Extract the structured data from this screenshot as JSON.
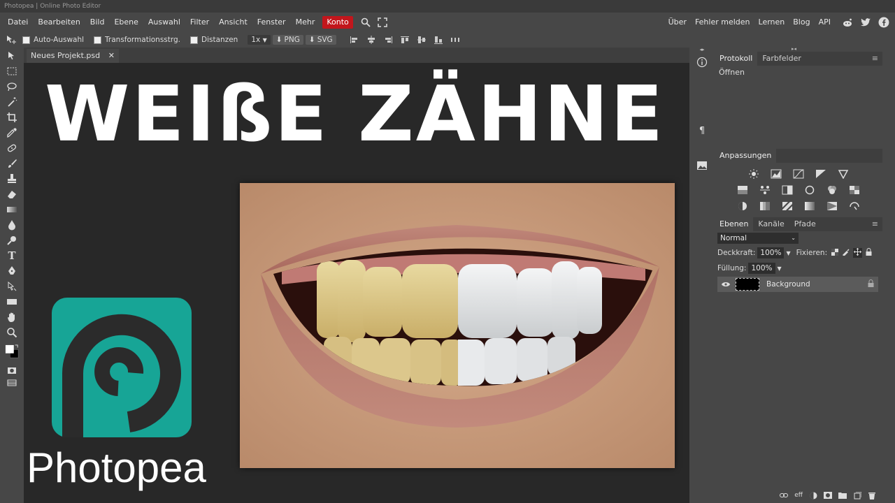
{
  "window": {
    "title": "Photopea | Online Photo Editor"
  },
  "menu": {
    "items": [
      "Datei",
      "Bearbeiten",
      "Bild",
      "Ebene",
      "Auswahl",
      "Filter",
      "Ansicht",
      "Fenster",
      "Mehr"
    ],
    "account": "Konto",
    "right_links": [
      "Über",
      "Fehler melden",
      "Lernen",
      "Blog",
      "API"
    ]
  },
  "options": {
    "auto_select": "Auto-Auswahl",
    "transform_controls": "Transformationsstrg.",
    "distances": "Distanzen",
    "zoom": "1x",
    "png": "PNG",
    "svg": "SVG"
  },
  "document": {
    "tab_name": "Neues Projekt.psd",
    "close": "✕"
  },
  "thumbnail": {
    "headline": "WEIßE ZÄHNE",
    "brand": "Photopea",
    "brand_color": "#17a596",
    "logo_dark": "#2b2b2b"
  },
  "panels": {
    "history": {
      "tabs": [
        "Protokoll",
        "Farbfelder"
      ],
      "items": [
        "Öffnen"
      ]
    },
    "adjustments": {
      "title": "Anpassungen"
    },
    "layers": {
      "tabs": [
        "Ebenen",
        "Kanäle",
        "Pfade"
      ],
      "blend_mode": "Normal",
      "opacity_label": "Deckkraft:",
      "opacity": "100%",
      "lock_label": "Fixieren:",
      "fill_label": "Füllung:",
      "fill": "100%",
      "layer_name": "Background",
      "footer_fx": "eff"
    }
  },
  "colors": {
    "accent_red": "#c2161c",
    "panel_bg": "#474747",
    "canvas_bg": "#282828"
  }
}
